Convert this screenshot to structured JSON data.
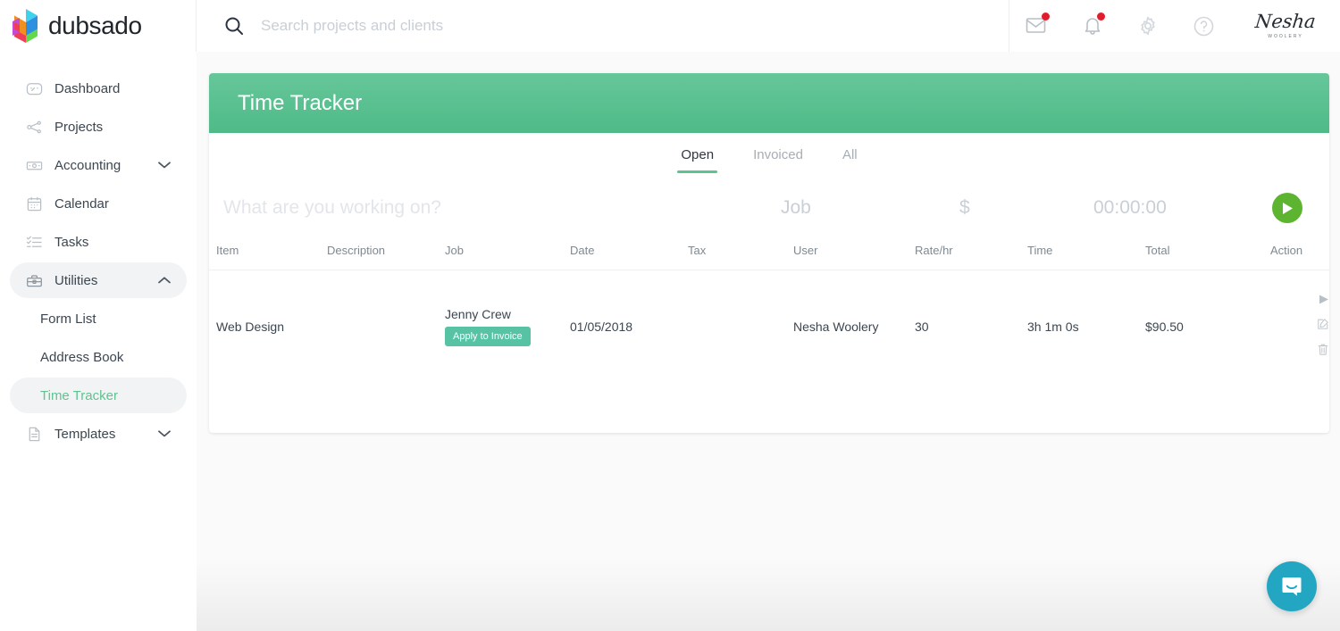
{
  "brand": {
    "name": "dubsado",
    "logo_icon": "dubsado-cube-logo"
  },
  "search": {
    "placeholder": "Search projects and clients",
    "value": "",
    "icon": "search-icon"
  },
  "topbar": {
    "mail_icon": "envelope-icon",
    "notifications_icon": "bell-icon",
    "settings_icon": "gear-icon",
    "help_icon": "question-circle-icon",
    "user": {
      "name": "Nesha",
      "surname": "Woolery"
    }
  },
  "sidebar": {
    "items": [
      {
        "label": "Dashboard",
        "icon": "speedometer-icon",
        "expandable": false,
        "active": false,
        "sub": false
      },
      {
        "label": "Projects",
        "icon": "workflow-icon",
        "expandable": false,
        "active": false,
        "sub": false
      },
      {
        "label": "Accounting",
        "icon": "money-icon",
        "expandable": true,
        "chevron": "down",
        "active": false,
        "sub": false
      },
      {
        "label": "Calendar",
        "icon": "calendar-icon",
        "expandable": false,
        "active": false,
        "sub": false
      },
      {
        "label": "Tasks",
        "icon": "checklist-icon",
        "expandable": false,
        "active": false,
        "sub": false
      },
      {
        "label": "Utilities",
        "icon": "toolbox-icon",
        "expandable": true,
        "chevron": "up",
        "active": true,
        "sub": false
      },
      {
        "label": "Form List",
        "icon": "",
        "expandable": false,
        "active": false,
        "sub": true
      },
      {
        "label": "Address Book",
        "icon": "",
        "expandable": false,
        "active": false,
        "sub": true
      },
      {
        "label": "Time Tracker",
        "icon": "",
        "expandable": false,
        "active": true,
        "current": true,
        "sub": true
      },
      {
        "label": "Templates",
        "icon": "document-icon",
        "expandable": true,
        "chevron": "down",
        "active": false,
        "sub": false
      }
    ]
  },
  "card": {
    "title": "Time Tracker",
    "tabs": [
      {
        "label": "Open",
        "active": true
      },
      {
        "label": "Invoiced",
        "active": false
      },
      {
        "label": "All",
        "active": false
      }
    ],
    "timer": {
      "task_placeholder": "What are you working on?",
      "task_value": "",
      "job_label": "Job",
      "rate_label": "$",
      "clock": "00:00:00",
      "play_icon": "play-icon"
    },
    "table": {
      "headers": [
        "Item",
        "Description",
        "Job",
        "Date",
        "Tax",
        "User",
        "Rate/hr",
        "Time",
        "Total",
        "Action"
      ],
      "rows": [
        {
          "item": "Web Design",
          "description": "",
          "job": "Jenny Crew",
          "job_action_label": "Apply to Invoice",
          "date": "01/05/2018",
          "tax": "",
          "user": "Nesha Woolery",
          "rate": "30",
          "time": "3h 1m 0s",
          "total": "$90.50",
          "actions": [
            "play-icon",
            "edit-icon",
            "trash-icon"
          ]
        }
      ]
    }
  },
  "chat": {
    "icon": "chat-bubble-icon"
  },
  "colors": {
    "header_green": "#4fba88",
    "accent_green": "#5ec48f",
    "play_green": "#5cb430",
    "teal_button": "#58c2a4",
    "badge_red": "#e31c2b",
    "chat_blue": "#23a6c2"
  }
}
